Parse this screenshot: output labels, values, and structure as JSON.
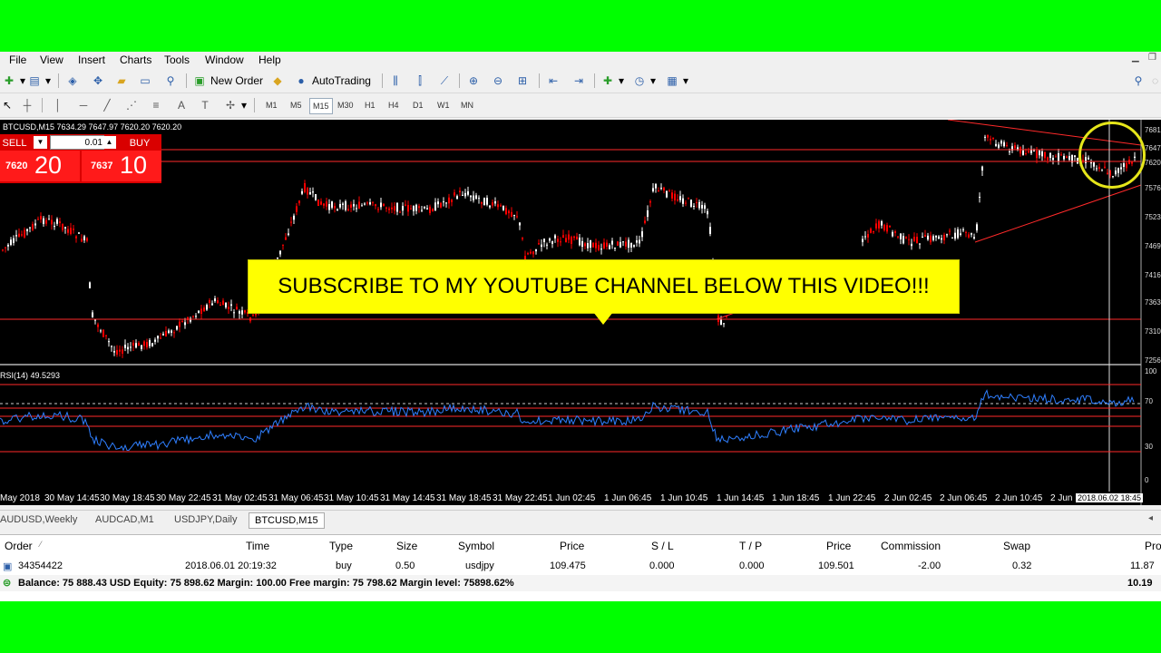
{
  "menu": {
    "file": "File",
    "view": "View",
    "insert": "Insert",
    "charts": "Charts",
    "tools": "Tools",
    "window": "Window",
    "help": "Help"
  },
  "toolbar": {
    "new_order": "New Order",
    "autotrading": "AutoTrading"
  },
  "timeframes": [
    "M1",
    "M5",
    "M15",
    "M30",
    "H1",
    "H4",
    "D1",
    "W1",
    "MN"
  ],
  "active_timeframe": "M15",
  "chart": {
    "header": "BTCUSD,M15  7634.29 7647.97 7620.20 7620.20",
    "sell_label": "SELL",
    "buy_label": "BUY",
    "lot": "0.01",
    "sell_price_small": "7620",
    "sell_price_big": "20",
    "buy_price_small": "7637",
    "buy_price_big": "10",
    "indicator_label": "RSI(14) 49.5293",
    "price_axis": [
      "7681",
      "7647",
      "7620",
      "7576",
      "7523",
      "7469",
      "7416",
      "7363",
      "7310",
      "7256"
    ],
    "indicator_axis": [
      "100",
      "70",
      "30",
      "0"
    ],
    "time_axis": [
      "May 2018",
      "30 May 14:45",
      "30 May 18:45",
      "30 May 22:45",
      "31 May 02:45",
      "31 May 06:45",
      "31 May 10:45",
      "31 May 14:45",
      "31 May 18:45",
      "31 May 22:45",
      "1 Jun 02:45",
      "1 Jun 06:45",
      "1 Jun 10:45",
      "1 Jun 14:45",
      "1 Jun 18:45",
      "1 Jun 22:45",
      "2 Jun 02:45",
      "2 Jun 06:45",
      "2 Jun 10:45",
      "2 Jun",
      "2018.06.02 18:45"
    ]
  },
  "banner": {
    "text": "SUBSCRIBE TO MY YOUTUBE CHANNEL BELOW THIS VIDEO!!!"
  },
  "chart_tabs": [
    "AUDUSD,Weekly",
    "AUDCAD,M1",
    "USDJPY,Daily",
    "BTCUSD,M15"
  ],
  "active_chart_tab": "BTCUSD,M15",
  "terminal": {
    "headers": [
      "Order",
      "Time",
      "Type",
      "Size",
      "Symbol",
      "Price",
      "S / L",
      "T / P",
      "Price",
      "Commission",
      "Swap",
      "Pro"
    ],
    "row": [
      "34354422",
      "2018.06.01 20:19:32",
      "buy",
      "0.50",
      "usdjpy",
      "109.475",
      "0.000",
      "0.000",
      "109.501",
      "-2.00",
      "0.32",
      "11.87"
    ],
    "balance": "Balance: 75 888.43 USD  Equity: 75 898.62  Margin: 100.00  Free margin: 75 798.62  Margin level: 75898.62%",
    "balance_profit": "10.19"
  },
  "colors": {
    "bull": "#ffffff",
    "bear": "#ff0000",
    "rsi": "#2f7fff",
    "banner": "#ffff00",
    "highlight_circle": "#e6e61a"
  }
}
